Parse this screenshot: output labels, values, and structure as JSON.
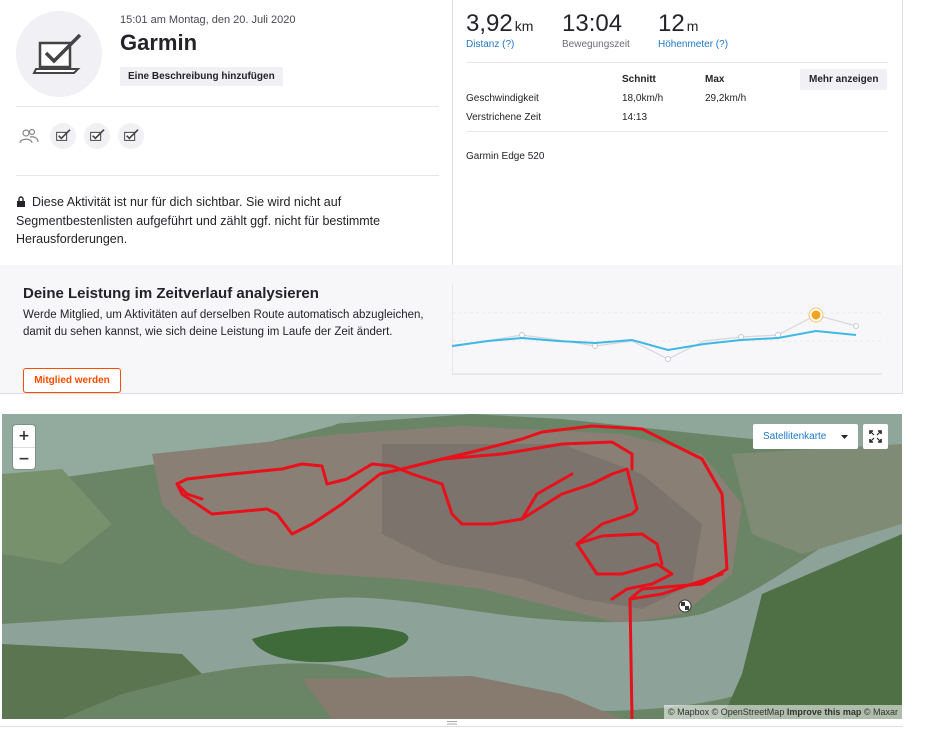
{
  "activity": {
    "date": "15:01 am Montag, den 20. Juli 2020",
    "title": "Garmin",
    "add_description_label": "Eine Beschreibung hinzufügen",
    "privacy_text": "Diese Aktivität ist nur für dich sichtbar. Sie wird nicht auf Segmentbestenlisten aufgeführt und zählt ggf. nicht für bestimmte Herausforderungen."
  },
  "stats": [
    {
      "value": "3,92",
      "unit": "km",
      "label": "Distanz (?)",
      "link": true
    },
    {
      "value": "13:04",
      "unit": "",
      "label": "Bewegungszeit",
      "link": false
    },
    {
      "value": "12",
      "unit": "m",
      "label": "Höhenmeter (?)",
      "link": true
    }
  ],
  "details": {
    "header_avg": "Schnitt",
    "header_max": "Max",
    "more_label": "Mehr anzeigen",
    "rows": [
      {
        "label": "Geschwindigkeit",
        "avg": "18,0km/h",
        "max": "29,2km/h"
      },
      {
        "label": "Verstrichene Zeit",
        "avg": "14:13",
        "max": ""
      }
    ],
    "device": "Garmin Edge 520"
  },
  "performance": {
    "title": "Deine Leistung im Zeitverlauf analysieren",
    "text": "Werde Mitglied, um Aktivitäten auf derselben Route automatisch abzugleichen, damit du sehen kannst, wie sich deine Leistung im Laufe der Zeit ändert.",
    "member_label": "Mitglied werden",
    "accent": "#fc4c02",
    "line_color": "#3fb8e6"
  },
  "map": {
    "zoom_in": "+",
    "zoom_out": "−",
    "layer_label": "Satellitenkarte",
    "attribution_prefix": "© Mapbox © OpenStreetMap ",
    "attribution_improve": "Improve this map",
    "attribution_suffix": " © Maxar",
    "route_color": "#e8101a"
  }
}
